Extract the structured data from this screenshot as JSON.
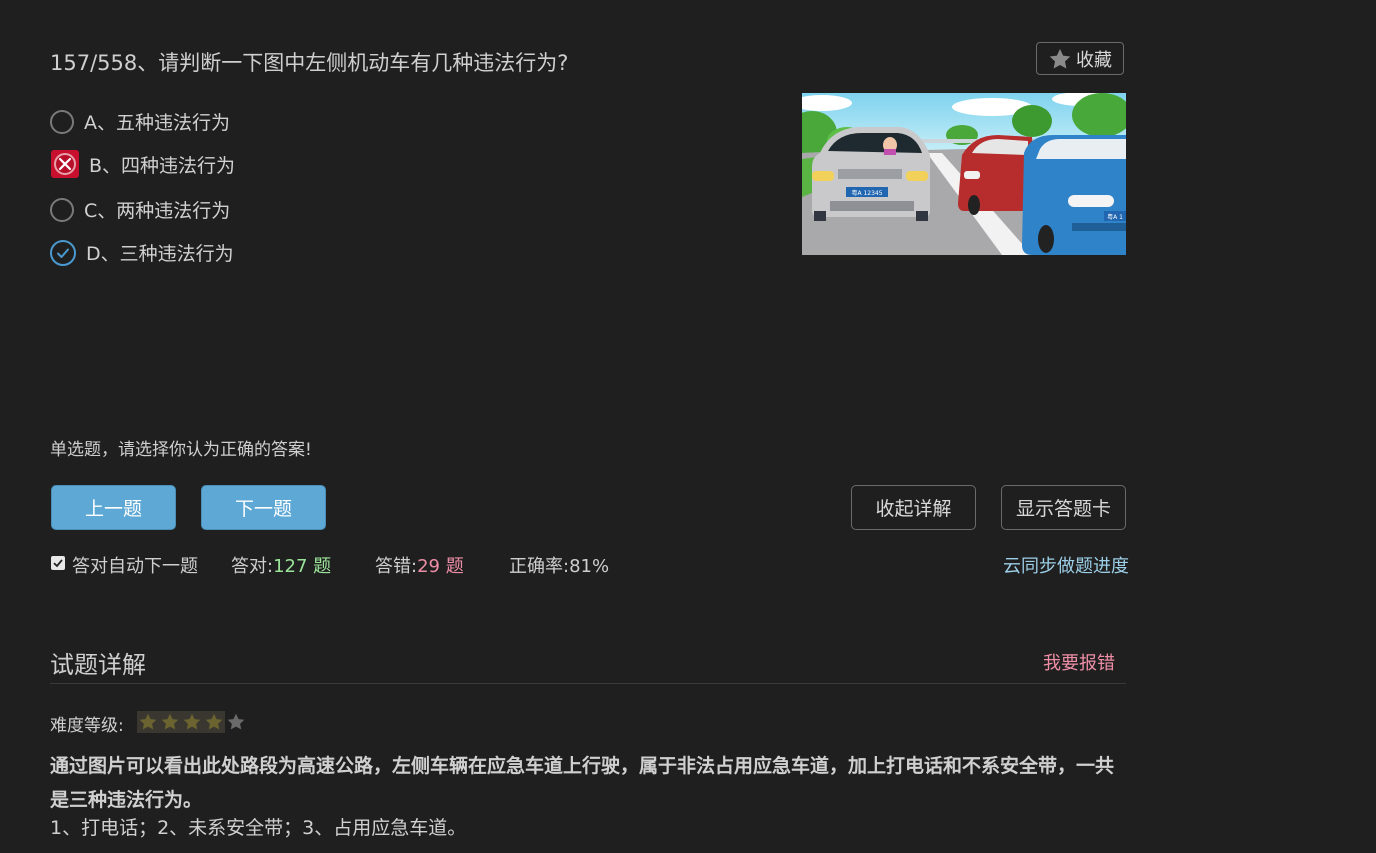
{
  "question": {
    "title": "157/558、请判断一下图中左侧机动车有几种违法行为?",
    "favorite_label": "收藏",
    "options": [
      {
        "label": "A、五种违法行为",
        "state": "none"
      },
      {
        "label": "B、四种违法行为",
        "state": "wrong"
      },
      {
        "label": "C、两种违法行为",
        "state": "none"
      },
      {
        "label": "D、三种违法行为",
        "state": "right"
      }
    ],
    "image": {
      "plate_left": "粤A 12345",
      "plate_right": "粤A 1"
    }
  },
  "hint": "单选题，请选择你认为正确的答案!",
  "buttons": {
    "prev": "上一题",
    "next": "下一题",
    "collapse": "收起详解",
    "answer_card": "显示答题卡"
  },
  "stats": {
    "auto_next_label": "答对自动下一题",
    "auto_next_checked": true,
    "correct_label": "答对:",
    "correct_value": "127 题",
    "wrong_label": "答错:",
    "wrong_value": "29 题",
    "rate_label": "正确率:",
    "rate_value": "81%",
    "sync_link": "云同步做题进度"
  },
  "explanation": {
    "section_title": "试题详解",
    "report_link": "我要报错",
    "difficulty_label": "难度等级:",
    "difficulty_stars": 4,
    "difficulty_max": 5,
    "text_bold": "通过图片可以看出此处路段为高速公路，左侧车辆在应急车道上行驶，属于非法占用应急车道，加上打电话和不系安全带，一共是三种违法行为。",
    "text_detail": "1、打电话；2、未系安全带；3、占用应急车道。"
  },
  "colors": {
    "background": "#1f1f1f",
    "primary_button": "#5ea8d6",
    "correct_green": "#9be59b",
    "wrong_pink": "#ee8ea6",
    "link_blue": "#9dcfe8",
    "wrong_red": "#c8102e",
    "right_blue": "#4a9ad0"
  },
  "icons": {
    "favorite": "star-icon",
    "wrong_mark": "x-icon",
    "right_mark": "check-icon",
    "difficulty": "star-icon"
  }
}
